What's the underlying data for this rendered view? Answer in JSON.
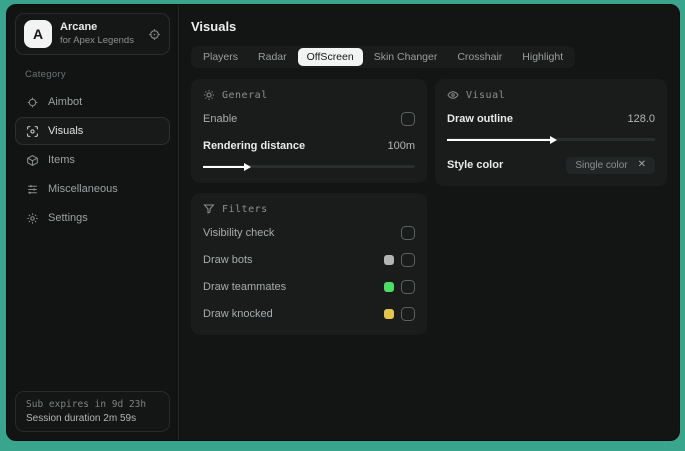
{
  "app": {
    "logo_letter": "A",
    "name": "Arcane",
    "subtitle": "for Apex Legends"
  },
  "sidebar": {
    "category_label": "Category",
    "items": [
      {
        "label": "Aimbot",
        "icon": "crosshair-icon",
        "active": false
      },
      {
        "label": "Visuals",
        "icon": "eye-scan-icon",
        "active": true
      },
      {
        "label": "Items",
        "icon": "cube-icon",
        "active": false
      },
      {
        "label": "Miscellaneous",
        "icon": "sliders-icon",
        "active": false
      },
      {
        "label": "Settings",
        "icon": "gear-icon",
        "active": false
      }
    ],
    "session": {
      "expires": "Sub expires in 9d 23h",
      "duration": "Session duration 2m 59s"
    }
  },
  "main": {
    "title": "Visuals",
    "tabs": [
      {
        "label": "Players",
        "active": false
      },
      {
        "label": "Radar",
        "active": false
      },
      {
        "label": "OffScreen",
        "active": true
      },
      {
        "label": "Skin Changer",
        "active": false
      },
      {
        "label": "Crosshair",
        "active": false
      },
      {
        "label": "Highlight",
        "active": false
      }
    ],
    "panels": {
      "general": {
        "title": "General",
        "enable_label": "Enable",
        "enable_checked": false,
        "distance_label": "Rendering distance",
        "distance_value": "100m",
        "slider_fill": "20%"
      },
      "filters": {
        "title": "Filters",
        "rows": [
          {
            "label": "Visibility check",
            "swatch": null,
            "checked": false
          },
          {
            "label": "Draw bots",
            "swatch": "#b3b5b4",
            "checked": false
          },
          {
            "label": "Draw teammates",
            "swatch": "#4ade63",
            "checked": false
          },
          {
            "label": "Draw knocked",
            "swatch": "#e2c54c",
            "checked": false
          }
        ]
      },
      "visual": {
        "title": "Visual",
        "outline_label": "Draw outline",
        "outline_value": "128.0",
        "slider_fill": "50%",
        "style_label": "Style color",
        "chip_label": "Single color",
        "chip_remove": "✕"
      }
    }
  },
  "colors": {
    "desktop_background": "#38a58c",
    "window_background": "#131515",
    "panel_background": "#1a1c1c",
    "accent_green": "#4ade63",
    "accent_yellow": "#e2c54c",
    "accent_gray": "#b3b5b4",
    "selected_tab": "#f2f3f3"
  }
}
